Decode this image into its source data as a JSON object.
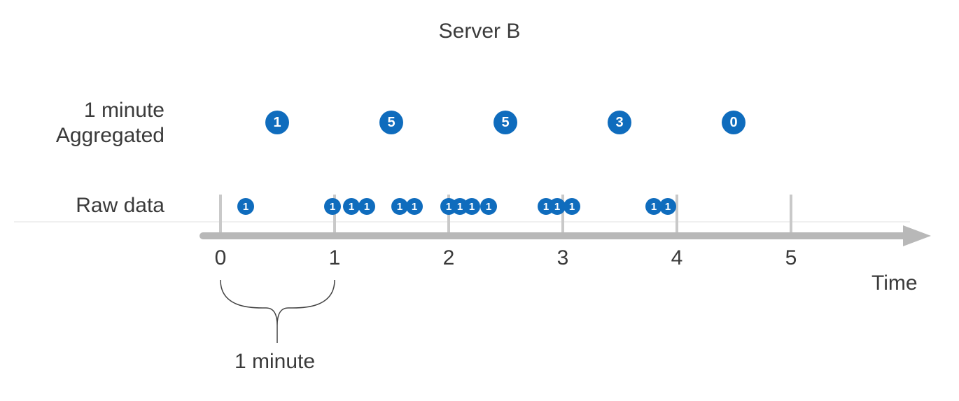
{
  "title": "Server B",
  "labels": {
    "aggregated_line1": "1 minute",
    "aggregated_line2": "Aggregated",
    "raw": "Raw data",
    "time_axis": "Time",
    "interval_caption": "1 minute"
  },
  "colors": {
    "dot": "#0f6cbd",
    "axis": "#b8b8b8",
    "tick": "#c9c9c9"
  },
  "chart_data": {
    "type": "timeline",
    "time_axis": {
      "min": 0,
      "max": 5,
      "unit": "minute",
      "ticks": [
        0,
        1,
        2,
        3,
        4,
        5
      ]
    },
    "raw_events": [
      {
        "t": 0.22,
        "v": 1
      },
      {
        "t": 0.98,
        "v": 1
      },
      {
        "t": 1.15,
        "v": 1
      },
      {
        "t": 1.28,
        "v": 1
      },
      {
        "t": 1.57,
        "v": 1
      },
      {
        "t": 1.7,
        "v": 1
      },
      {
        "t": 2.0,
        "v": 1
      },
      {
        "t": 2.1,
        "v": 1
      },
      {
        "t": 2.2,
        "v": 1
      },
      {
        "t": 2.35,
        "v": 1
      },
      {
        "t": 2.85,
        "v": 1
      },
      {
        "t": 2.95,
        "v": 1
      },
      {
        "t": 3.08,
        "v": 1
      },
      {
        "t": 3.8,
        "v": 1
      },
      {
        "t": 3.92,
        "v": 1
      }
    ],
    "aggregated": [
      {
        "bucket_start": 0,
        "center_t": 0.5,
        "value": 1
      },
      {
        "bucket_start": 1,
        "center_t": 1.5,
        "value": 5
      },
      {
        "bucket_start": 2,
        "center_t": 2.5,
        "value": 5
      },
      {
        "bucket_start": 3,
        "center_t": 3.5,
        "value": 3
      },
      {
        "bucket_start": 4,
        "center_t": 4.5,
        "value": 0
      }
    ],
    "interval_bracket": {
      "from": 0,
      "to": 1,
      "label": "1 minute"
    }
  }
}
